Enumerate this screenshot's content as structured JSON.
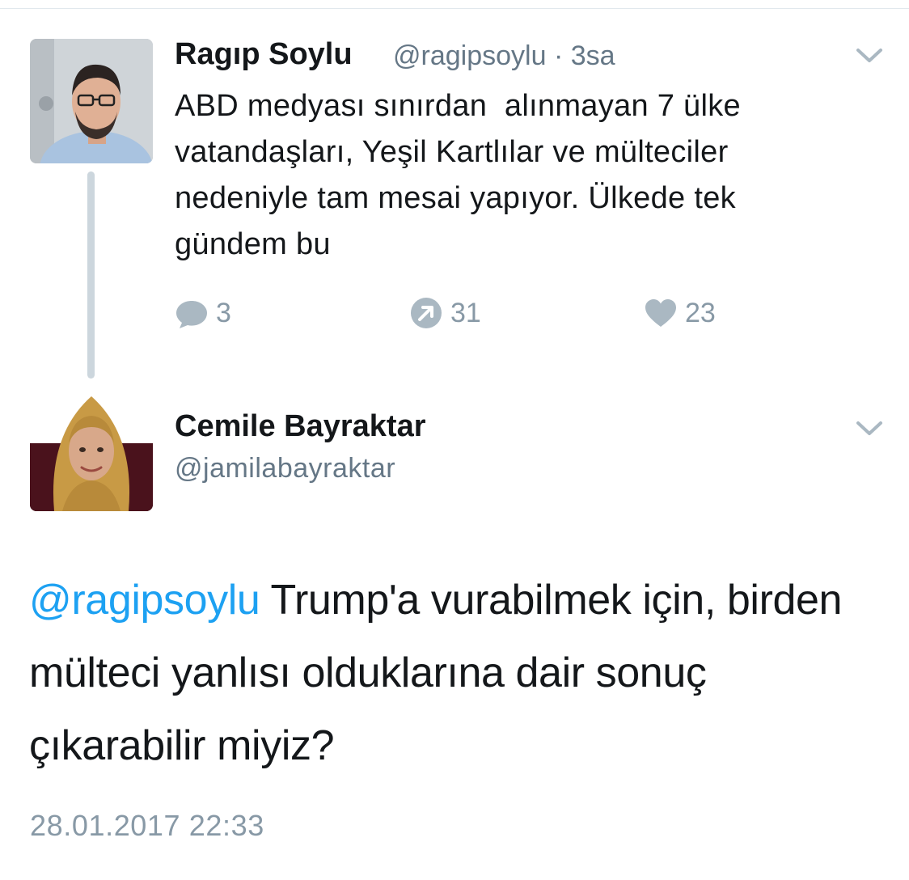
{
  "parent_tweet": {
    "author_name": "Ragıp Soylu",
    "author_handle": "@ragipsoylu",
    "separator": "·",
    "time_ago": "3sa",
    "text": "ABD medyası sınırdan  alınmayan 7 ülke\nvatandaşları, Yeşil Kartlılar ve mülteciler\nnedeniyle tam mesai yapıyor. Ülkede tek\ngündem bu",
    "actions": {
      "reply": {
        "icon": "reply-icon",
        "count": "3"
      },
      "retweet": {
        "icon": "retweet-icon",
        "count": "31"
      },
      "like": {
        "icon": "heart-icon",
        "count": "23"
      }
    },
    "menu_icon": "chevron-down-icon"
  },
  "reply_tweet": {
    "author_name": "Cemile Bayraktar",
    "author_handle": "@jamilabayraktar",
    "mention": "@ragipsoylu",
    "text": " Trump'a vurabilmek için, birden mülteci yanlısı olduklarına dair sonuç çıkarabilir miyiz?",
    "timestamp": "28.01.2017 22:33",
    "menu_icon": "chevron-down-icon"
  },
  "colors": {
    "link": "#1da1f2",
    "secondary_text": "#657786",
    "icon_gray": "#aab8c2",
    "thread_line": "#ccd6dd",
    "primary_text": "#14171a"
  }
}
